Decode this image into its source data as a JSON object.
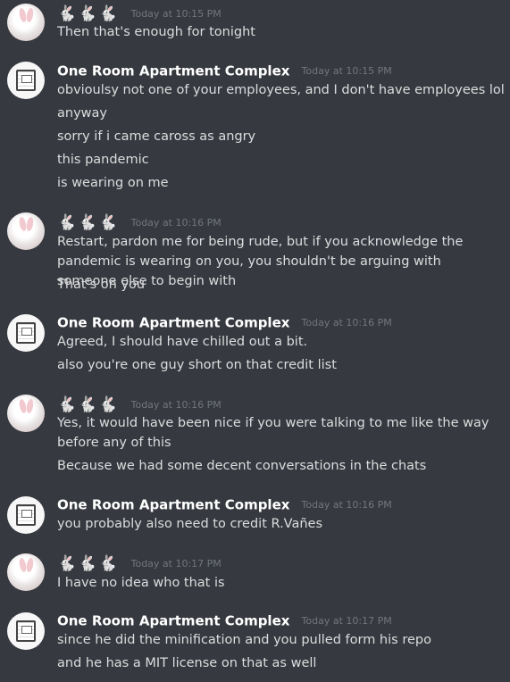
{
  "chat": {
    "groups": [
      {
        "author": "🐇🐇🐇",
        "timestamp": "Today at 10:15 PM",
        "messages": [
          "Then that's enough for tonight"
        ]
      },
      {
        "author": "One Room Apartment Complex",
        "timestamp": "Today at 10:15 PM",
        "messages": [
          "obvioulsy not one of your employees, and I don't have employees lol",
          "anyway",
          "sorry if i came caross as angry",
          "this pandemic",
          "is wearing on me"
        ]
      },
      {
        "author": "🐇🐇🐇",
        "timestamp": "Today at 10:16 PM",
        "messages": [
          "Restart, pardon me for being rude, but if you acknowledge the pandemic is wearing on you, you shouldn't be arguing with someone else to begin with",
          "That's on you"
        ]
      },
      {
        "author": "One Room Apartment Complex",
        "timestamp": "Today at 10:16 PM",
        "messages": [
          "Agreed, I should have chilled out a bit.",
          "also you're one guy short on that credit list"
        ]
      },
      {
        "author": "🐇🐇🐇",
        "timestamp": "Today at 10:16 PM",
        "messages": [
          "Yes, it would have been nice if you were talking to me like the way before any of this",
          "Because we had some decent conversations in the chats"
        ]
      },
      {
        "author": "One Room Apartment Complex",
        "timestamp": "Today at 10:16 PM",
        "messages": [
          "you probably also need to credit R.Vañes"
        ]
      },
      {
        "author": "🐇🐇🐇",
        "timestamp": "Today at 10:17 PM",
        "messages": [
          "I have no idea who that is"
        ]
      },
      {
        "author": "One Room Apartment Complex",
        "timestamp": "Today at 10:17 PM",
        "messages": [
          "since he did the minification and you pulled form his repo",
          "and he has a MIT license on that as well"
        ]
      }
    ]
  },
  "colors": {
    "background": "#36393f",
    "username": "#ffffff",
    "message_text": "#dcddde",
    "timestamp": "#72767d"
  },
  "icons": {
    "rabbit_avatar": "rabbit-avatar-icon",
    "apartment_avatar": "apartment-avatar-icon"
  }
}
